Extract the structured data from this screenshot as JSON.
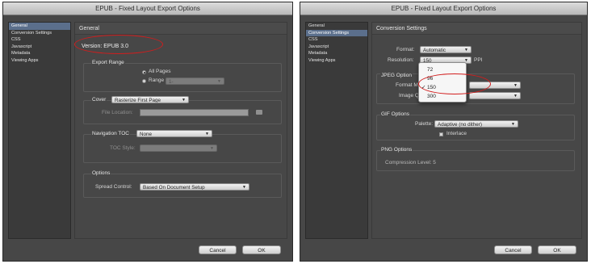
{
  "left": {
    "title": "EPUB - Fixed Layout Export Options",
    "sidebar": [
      "General",
      "Conversion Settings",
      "CSS",
      "Javascript",
      "Metadata",
      "Viewing Apps"
    ],
    "section": "General",
    "version": "Version: EPUB 3.0",
    "export_range": {
      "title": "Export Range",
      "all_pages": "All Pages",
      "range": "Range",
      "range_value": "1-"
    },
    "cover": {
      "label": "Cover",
      "value": "Rasterize First Page",
      "file_location": "File Location:"
    },
    "nav_toc": {
      "label": "Navigation TOC",
      "value": "None",
      "toc_style": "TOC Style:"
    },
    "options": {
      "title": "Options",
      "spread_label": "Spread Control:",
      "spread_value": "Based On Document Setup"
    },
    "cancel": "Cancel",
    "ok": "OK"
  },
  "right": {
    "title": "EPUB - Fixed Layout Export Options",
    "sidebar": [
      "General",
      "Conversion Settings",
      "CSS",
      "Javascript",
      "Metadata",
      "Viewing Apps"
    ],
    "section": "Conversion Settings",
    "format_label": "Format:",
    "format_value": "Automatic",
    "resolution_label": "Resolution:",
    "resolution_value": "150",
    "ppi": "PPI",
    "jpeg": {
      "title": "JPEG Option",
      "format_method": "Format M",
      "image_quality": "Image Q"
    },
    "resolution_options": [
      "72",
      "96",
      "150",
      "300"
    ],
    "resolution_checked": "150",
    "gif": {
      "title": "GIF Options",
      "palette_label": "Palette:",
      "palette_value": "Adaptive (no dither)",
      "interlace": "Interlace"
    },
    "png": {
      "title": "PNG Options",
      "compression": "Compression Level: 5"
    },
    "cancel": "Cancel",
    "ok": "OK"
  },
  "colors": {
    "dialog_bg": "#474747",
    "sidebar_selected": "#5b6f8c",
    "annotation": "#d21d1d"
  }
}
